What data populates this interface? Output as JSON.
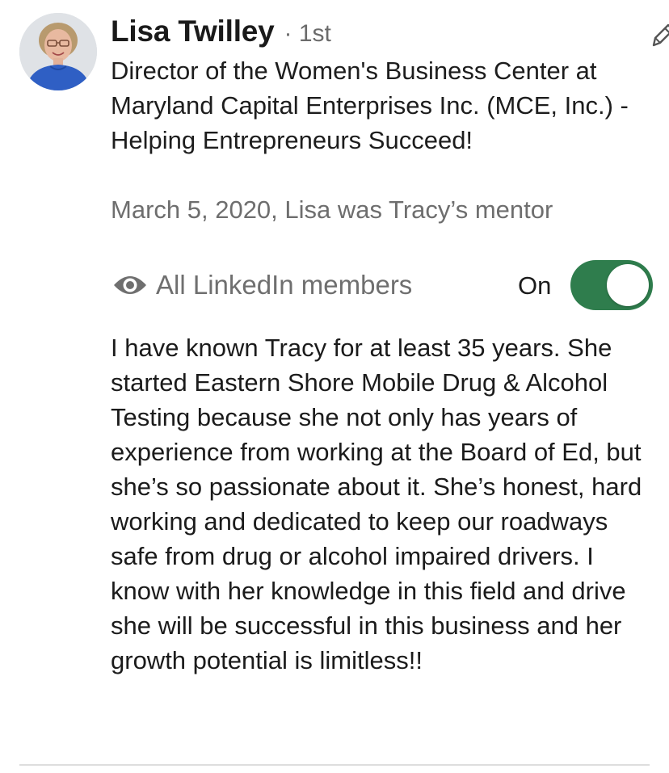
{
  "recommender": {
    "name": "Lisa Twilley",
    "degree": "· 1st",
    "headline": "Director of the Women's Business Center at Maryland Capital Enterprises Inc. (MCE, Inc.) - Helping Entrepreneurs Succeed!",
    "relation": "March 5, 2020, Lisa was Tracy’s mentor",
    "avatar_icon": "profile-photo",
    "edit_icon": "pencil-icon"
  },
  "visibility": {
    "icon": "eye-icon",
    "label": "All LinkedIn members",
    "toggle_label": "On",
    "toggle_on": true,
    "toggle_color": "#2f7d4d"
  },
  "recommendation_text": "I have known Tracy for at least 35 years.  She started Eastern Shore Mobile Drug & Alcohol Testing because she not only has years of experience from working at the Board of Ed, but she’s so passionate about it.  She’s honest, hard working and dedicated to keep our roadways safe from drug or alcohol impaired drivers.  I know with her knowledge in this field and drive she will be successful in this business and her growth potential is limitless!!"
}
